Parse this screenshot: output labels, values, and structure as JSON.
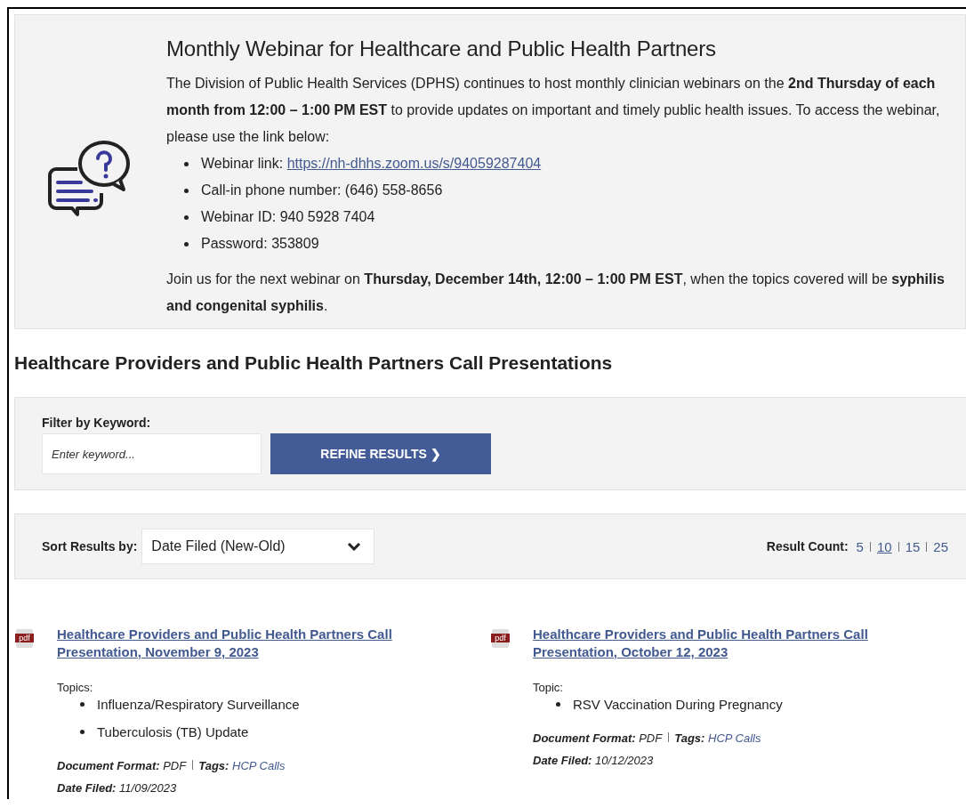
{
  "webinar": {
    "title": "Monthly Webinar for Healthcare and Public Health Partners",
    "intro": "The Division of Public Health Services (DPHS) continues to host monthly clinician webinars on the **2nd Thursday of each month from 12:00 – 1:00 PM EST** to provide updates on important and timely public health issues. To access the webinar, please use the link below:",
    "details": [
      {
        "text": "Webinar link:",
        "link": "https://nh-dhhs.zoom.us/s/94059287404"
      },
      {
        "text": "Call-in phone number: (646) 558-8656"
      },
      {
        "text": "Webinar ID: 940 5928 7404"
      },
      {
        "text": "Password: 353809"
      }
    ],
    "closing": "Join us for the next webinar on **Thursday, December 14th, 12:00 – 1:00 PM EST**, when the topics covered will be **syphilis and congenital syphilis**."
  },
  "section_title": "Healthcare Providers and Public Health Partners Call Presentations",
  "filter": {
    "label": "Filter by Keyword:",
    "placeholder": "Enter keyword...",
    "button": "REFINE RESULTS ❯"
  },
  "sort": {
    "label": "Sort Results by:",
    "value": "Date Filed (New-Old)",
    "count_label": "Result Count:",
    "counts": [
      {
        "label": "5",
        "selected": false
      },
      {
        "label": "10",
        "selected": true
      },
      {
        "label": "15",
        "selected": false
      },
      {
        "label": "25",
        "selected": false
      }
    ]
  },
  "documents": [
    {
      "file_label": "pdf",
      "title": "Healthcare Providers and Public Health Partners Call Presentation, November 9, 2023",
      "topics_label": "Topics:",
      "topics": [
        "Influenza/Respiratory Surveillance",
        "Tuberculosis (TB) Update"
      ],
      "format_label": "Document Format:",
      "format": "PDF",
      "tags_label": "Tags:",
      "tags": "HCP Calls",
      "date_label": "Date Filed:",
      "date": "11/09/2023"
    },
    {
      "file_label": "pdf",
      "title": "Healthcare Providers and Public Health Partners Call Presentation, October 12, 2023",
      "topics_label": "Topic:",
      "topics": [
        "RSV Vaccination During Pregnancy"
      ],
      "format_label": "Document Format:",
      "format": "PDF",
      "tags_label": "Tags:",
      "tags": "HCP Calls",
      "date_label": "Date Filed:",
      "date": "10/12/2023"
    }
  ]
}
